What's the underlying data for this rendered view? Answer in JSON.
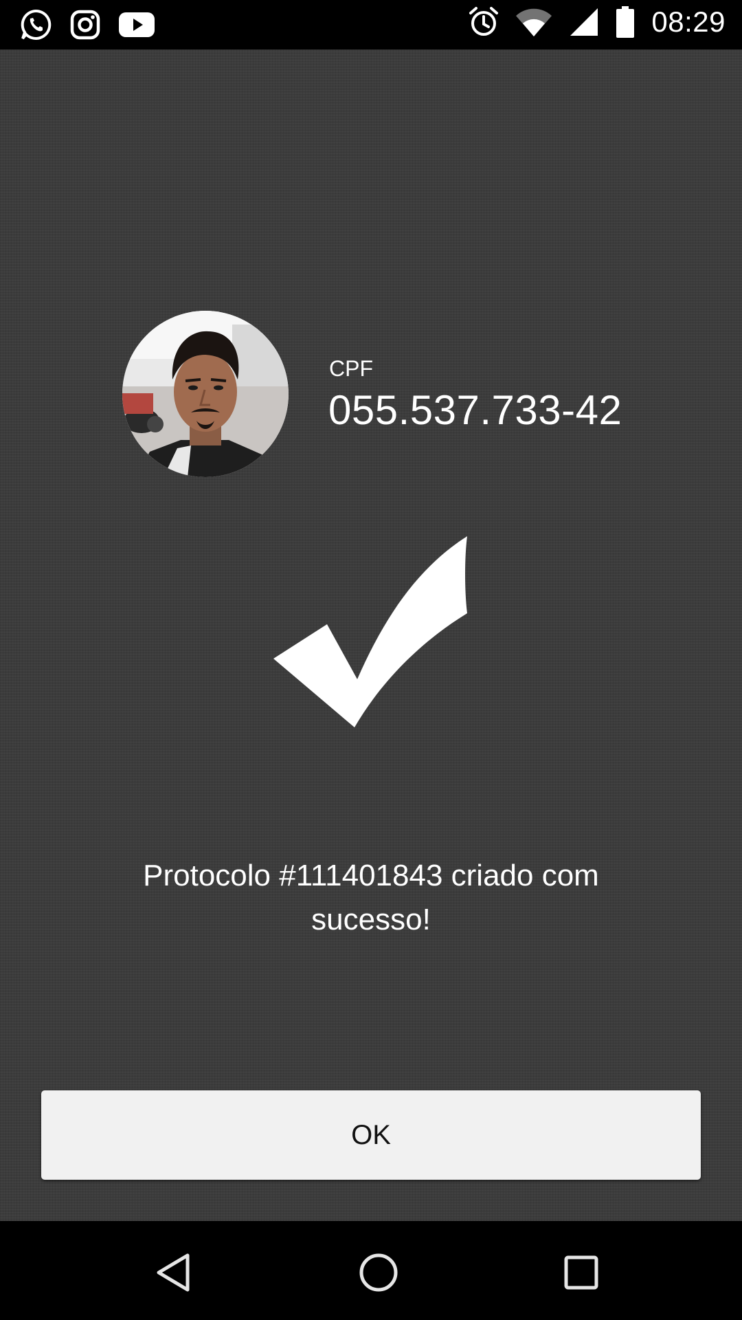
{
  "status_bar": {
    "left_icons": [
      "whatsapp-icon",
      "instagram-icon",
      "youtube-icon"
    ],
    "right_icons": [
      "alarm-icon",
      "wifi-icon",
      "cell-signal-icon",
      "battery-icon"
    ],
    "time": "08:29"
  },
  "profile": {
    "avatar_icon": "user-photo",
    "cpf_label": "CPF",
    "cpf_value": "055.537.733-42"
  },
  "result": {
    "icon": "check-mark-icon",
    "message": "Protocolo #111401843 criado com sucesso!"
  },
  "actions": {
    "ok_label": "OK"
  },
  "nav_bar": {
    "buttons": [
      "back-icon",
      "home-icon",
      "recents-icon"
    ]
  },
  "colors": {
    "background": "#3c3c3c",
    "bars": "#000000",
    "button": "#f1f1f1",
    "text": "#ffffff"
  }
}
